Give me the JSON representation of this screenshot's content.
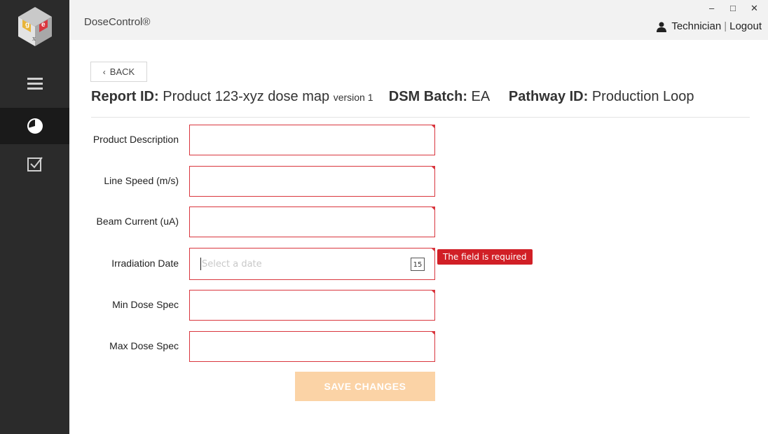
{
  "app": {
    "title": "DoseControl®"
  },
  "window_controls": {
    "minimize": "–",
    "maximize": "□",
    "close": "✕"
  },
  "user": {
    "role": "Technician",
    "logout": "Logout"
  },
  "sidebar": {
    "logo_icon": "gex-cube-logo",
    "items": [
      {
        "icon": "hamburger-menu-icon",
        "active": false
      },
      {
        "icon": "pie-chart-icon",
        "active": true
      },
      {
        "icon": "checkbox-icon",
        "active": false
      }
    ]
  },
  "back_label": "BACK",
  "report": {
    "report_id_label": "Report ID:",
    "report_id_value": "Product 123-xyz dose map",
    "version_text": "version 1",
    "dsm_batch_label": "DSM Batch:",
    "dsm_batch_value": "EA",
    "pathway_id_label": "Pathway ID:",
    "pathway_id_value": "Production Loop"
  },
  "form": {
    "fields": [
      {
        "label": "Product Description",
        "value": ""
      },
      {
        "label": "Line Speed (m/s)",
        "value": ""
      },
      {
        "label": "Beam Current (uA)",
        "value": ""
      },
      {
        "label": "Irradiation Date",
        "value": "",
        "placeholder": "Select a date",
        "calendar_text": "15",
        "error": "The field is required"
      },
      {
        "label": "Min Dose Spec",
        "value": ""
      },
      {
        "label": "Max Dose Spec",
        "value": ""
      }
    ],
    "save_label": "SAVE CHANGES"
  },
  "colors": {
    "sidebar_bg": "#2b2b2b",
    "error": "#d11f26",
    "field_border": "#d9363e",
    "save_button": "#fbd3a6"
  }
}
